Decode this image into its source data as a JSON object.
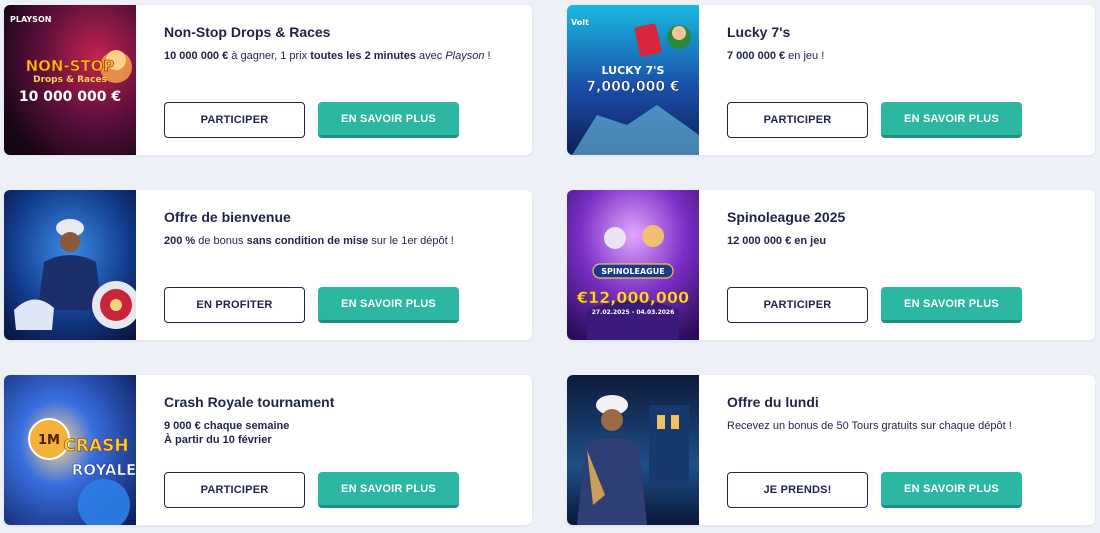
{
  "promotions": [
    {
      "title": "Non-Stop Drops & Races",
      "desc_parts": [
        {
          "t": "10 000 000 €",
          "s": "b"
        },
        {
          "t": " à gagner, 1 prix ",
          "s": "n"
        },
        {
          "t": "toutes les 2 minutes",
          "s": "b"
        },
        {
          "t": " avec ",
          "s": "n"
        },
        {
          "t": "Playson",
          "s": "i"
        },
        {
          "t": " !",
          "s": "n"
        }
      ],
      "primary_label": "PARTICIPER",
      "secondary_label": "EN SAVOIR PLUS",
      "image": {
        "brand": "PLAYSON",
        "line1": "NON-STOP",
        "line2": "Drops & Races",
        "line3": "10 000 000 €"
      }
    },
    {
      "title": "Lucky 7's",
      "desc_parts": [
        {
          "t": "7 000 000 €",
          "s": "b"
        },
        {
          "t": " en jeu !",
          "s": "n"
        }
      ],
      "primary_label": "PARTICIPER",
      "secondary_label": "EN SAVOIR PLUS",
      "image": {
        "brand": "Volt",
        "line1": "LUCKY 7'S",
        "line2": "7,000,000 €"
      }
    },
    {
      "title": "Offre de bienvenue",
      "desc_parts": [
        {
          "t": "200 %",
          "s": "b"
        },
        {
          "t": " de bonus ",
          "s": "n"
        },
        {
          "t": "sans condition de mise",
          "s": "b"
        },
        {
          "t": " sur le 1er dépôt !",
          "s": "n"
        }
      ],
      "primary_label": "EN PROFITER",
      "secondary_label": "EN SAVOIR PLUS",
      "image": {}
    },
    {
      "title": "Spinoleague 2025",
      "desc_parts": [
        {
          "t": "12 000 000 €",
          "s": "b"
        },
        {
          "t": " en jeu",
          "s": "b"
        }
      ],
      "primary_label": "PARTICIPER",
      "secondary_label": "EN SAVOIR PLUS",
      "image": {
        "line1": "SPINOLEAGUE",
        "line2": "€12,000,000",
        "line3": "27.02.2025 - 04.03.2026"
      }
    },
    {
      "title": "Crash Royale tournament",
      "desc_parts": [
        {
          "t": "9 000 € chaque semaine",
          "s": "b"
        },
        {
          "t": "À partir du 10 février",
          "s": "b",
          "br": true
        }
      ],
      "primary_label": "PARTICIPER",
      "secondary_label": "EN SAVOIR PLUS",
      "image": {
        "line1": "1M",
        "line2": "CRASH",
        "line3": "ROYALE"
      }
    },
    {
      "title": "Offre du lundi",
      "desc_parts": [
        {
          "t": "Recevez un bonus de 50 Tours gratuits sur chaque dépôt !",
          "s": "n"
        }
      ],
      "primary_label": "JE PRENDS!",
      "secondary_label": "EN SAVOIR PLUS",
      "image": {}
    }
  ],
  "colors": {
    "accent": "#2cb7a3",
    "text": "#1f2445",
    "background": "#eef0f7"
  }
}
